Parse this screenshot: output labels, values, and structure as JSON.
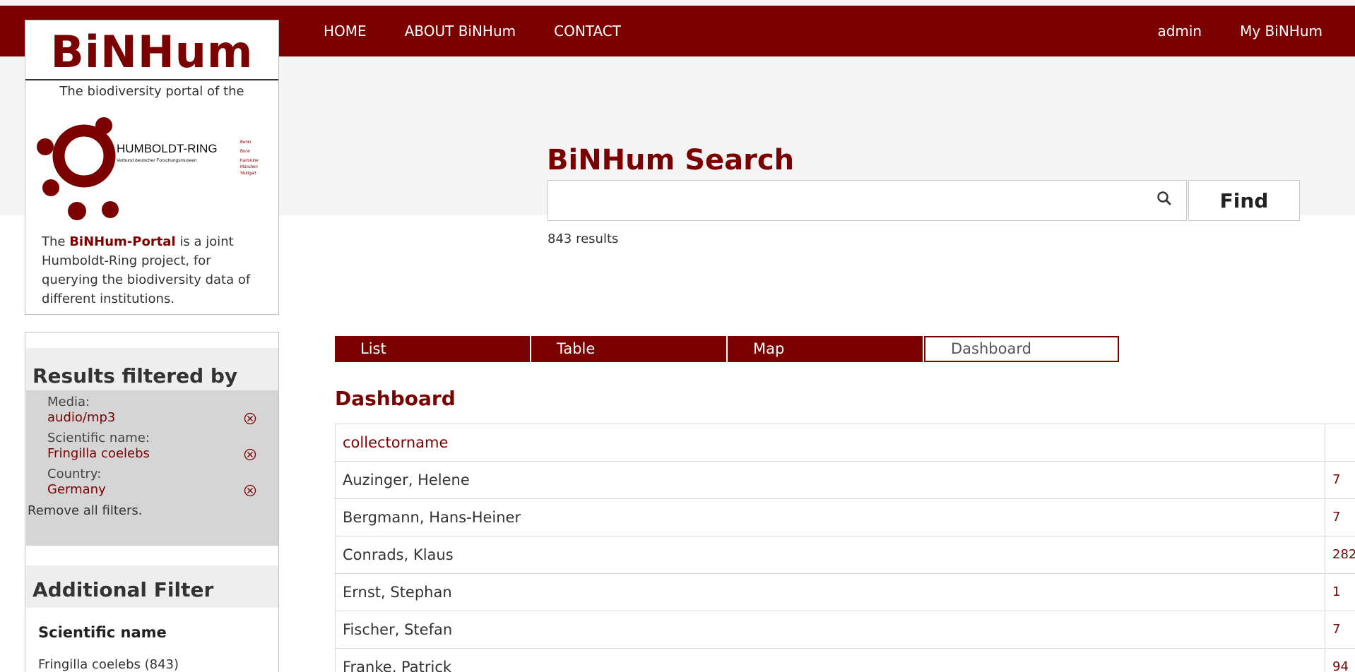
{
  "nav": {
    "left": [
      "HOME",
      "ABOUT BiNHum",
      "CONTACT"
    ],
    "right": [
      "admin",
      "My BiNHum"
    ]
  },
  "logo": {
    "brand": "BiNHum",
    "tagline": "The biodiversity portal of the",
    "ring_name": "HUMBOLDT-RING",
    "ring_subtitle": "Verbund deutscher Forschungsmuseen",
    "ring_cities": [
      "Berlin",
      "Bonn",
      "Karlsruhe",
      "München",
      "Stuttgart"
    ],
    "description_prefix": "The ",
    "description_bold": "BiNHum-Portal",
    "description_suffix": " is a joint Humboldt-Ring project, for querying the biodiversity data of different institutions."
  },
  "colors": {
    "primary": "#7b0000",
    "filter_bg": "#d5d5d5"
  },
  "filters": {
    "title": "Results filtered by",
    "items": [
      {
        "label": "Media:",
        "value": "audio/mp3"
      },
      {
        "label": "Scientific name:",
        "value": "Fringilla coelebs"
      },
      {
        "label": "Country:",
        "value": "Germany"
      }
    ],
    "remove_all": "Remove all filters."
  },
  "additional_filter": {
    "title": "Additional Filter",
    "section_title": "Scientific name",
    "items": [
      "Fringilla coelebs (843)"
    ]
  },
  "search": {
    "title": "BiNHum Search",
    "value": "",
    "button": "Find",
    "results_count": "843 results"
  },
  "view_tabs": [
    {
      "label": "List",
      "active": false
    },
    {
      "label": "Table",
      "active": false
    },
    {
      "label": "Map",
      "active": false
    },
    {
      "label": "Dashboard",
      "active": true
    }
  ],
  "dashboard": {
    "title": "Dashboard",
    "header": "collectorname",
    "rows": [
      {
        "name": "Auzinger, Helene",
        "count": "7"
      },
      {
        "name": "Bergmann, Hans-Heiner",
        "count": "7"
      },
      {
        "name": "Conrads, Klaus",
        "count": "282"
      },
      {
        "name": "Ernst, Stephan",
        "count": "1"
      },
      {
        "name": "Fischer, Stefan",
        "count": "7"
      },
      {
        "name": "Franke, Patrick",
        "count": "94"
      }
    ]
  }
}
